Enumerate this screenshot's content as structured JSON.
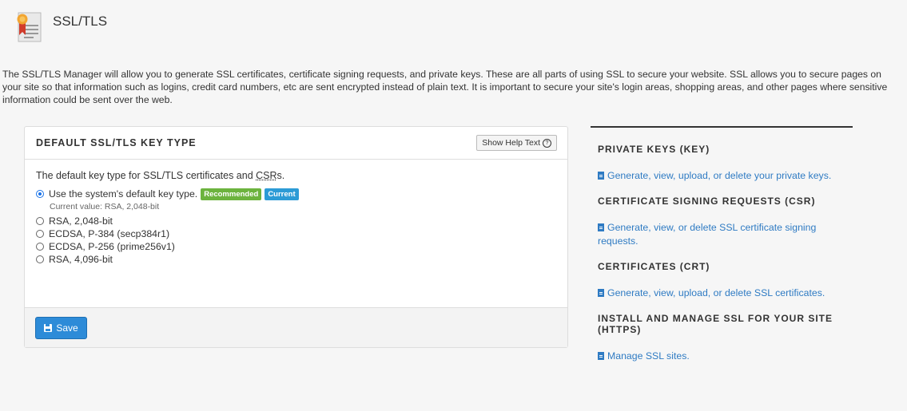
{
  "header": {
    "title": "SSL/TLS"
  },
  "intro": "The SSL/TLS Manager will allow you to generate SSL certificates, certificate signing requests, and private keys. These are all parts of using SSL to secure your website. SSL allows you to secure pages on your site so that information such as logins, credit card numbers, etc are sent encrypted instead of plain text. It is important to secure your site's login areas, shopping areas, and other pages where sensitive information could be sent over the web.",
  "panel": {
    "title": "DEFAULT SSL/TLS KEY TYPE",
    "help_button": "Show Help Text",
    "description_prefix": "The default key type for SSL/TLS certificates and ",
    "description_abbr": "CSR",
    "description_suffix": "s.",
    "options": [
      {
        "label": "Use the system's default key type.",
        "checked": true
      },
      {
        "label": "RSA, 2,048-bit",
        "checked": false
      },
      {
        "label": "ECDSA, P-384 (secp384r1)",
        "checked": false
      },
      {
        "label": "ECDSA, P-256 (prime256v1)",
        "checked": false
      },
      {
        "label": "RSA, 4,096-bit",
        "checked": false
      }
    ],
    "badge_recommended": "Recommended",
    "badge_current": "Current",
    "current_value": "Current value: RSA, 2,048-bit",
    "save_label": "Save"
  },
  "right": {
    "sections": [
      {
        "title": "PRIVATE KEYS (KEY)",
        "link": "Generate, view, upload, or delete your private keys."
      },
      {
        "title": "CERTIFICATE SIGNING REQUESTS (CSR)",
        "link": "Generate, view, or delete SSL certificate signing requests."
      },
      {
        "title": "CERTIFICATES (CRT)",
        "link": "Generate, view, upload, or delete SSL certificates."
      },
      {
        "title": "INSTALL AND MANAGE SSL FOR YOUR SITE (HTTPS)",
        "link": "Manage SSL sites."
      }
    ]
  },
  "colors": {
    "link": "#2f7bc3",
    "save_button": "#2d8bd8",
    "badge_recommended": "#6cb33e",
    "badge_current": "#2c9bd6"
  }
}
